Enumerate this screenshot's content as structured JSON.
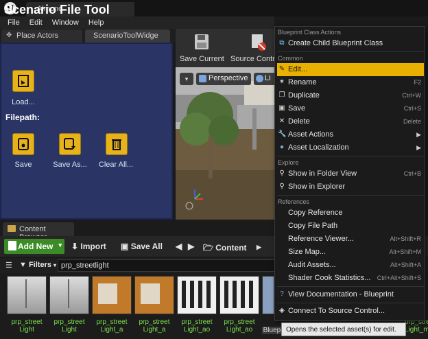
{
  "window": {
    "title": "Almono"
  },
  "menu": [
    "File",
    "Edit",
    "Window",
    "Help"
  ],
  "panel_tabs": {
    "place_actors": "Place Actors",
    "scenario_widget": "ScenarioToolWidge"
  },
  "scenario": {
    "title": "Scenario File Tool",
    "load": "Load...",
    "filepath": "Filepath:",
    "save": "Save",
    "save_as": "Save As...",
    "clear_all": "Clear All..."
  },
  "toolbar": {
    "save_current": "Save Current",
    "source_control": "Source Contro"
  },
  "viewport": {
    "perspective": "Perspective",
    "lit": "Li"
  },
  "content_browser": {
    "tab": "Content Browser",
    "add_new": "Add New",
    "import": "Import",
    "save_all": "Save All",
    "content": "Content",
    "filters": "Filters",
    "search": "prp_streetlight"
  },
  "assets": [
    {
      "l1": "prp_street",
      "l2": "Light"
    },
    {
      "l1": "prp_street",
      "l2": "Light"
    },
    {
      "l1": "prp_street",
      "l2": "Light_a"
    },
    {
      "l1": "prp_street",
      "l2": "Light_a"
    },
    {
      "l1": "prp_street",
      "l2": "Light_ao"
    },
    {
      "l1": "prp_street",
      "l2": "Light_ao"
    },
    {
      "l1": "",
      "l2": "Blueprin"
    },
    {
      "l1": "prp_street",
      "l2": "Light_m"
    }
  ],
  "context_menu": {
    "sec_blueprint": "Blueprint Class Actions",
    "create_child": "Create Child Blueprint Class",
    "sec_common": "Common",
    "edit": "Edit...",
    "rename": "Rename",
    "rename_sc": "F2",
    "duplicate": "Duplicate",
    "duplicate_sc": "Ctrl+W",
    "save": "Save",
    "save_sc": "Ctrl+S",
    "delete": "Delete",
    "delete_sc": "Delete",
    "asset_actions": "Asset Actions",
    "asset_localization": "Asset Localization",
    "sec_explore": "Explore",
    "show_folder": "Show in Folder View",
    "show_folder_sc": "Ctrl+B",
    "show_explorer": "Show in Explorer",
    "sec_references": "References",
    "copy_reference": "Copy Reference",
    "copy_path": "Copy File Path",
    "ref_viewer": "Reference Viewer...",
    "ref_viewer_sc": "Alt+Shift+R",
    "size_map": "Size Map...",
    "size_map_sc": "Alt+Shift+M",
    "audit": "Audit Assets...",
    "audit_sc": "Alt+Shift+A",
    "shader_stats": "Shader Cook Statistics...",
    "shader_stats_sc": "Ctrl+Alt+Shift+S",
    "view_docs": "View Documentation - Blueprint",
    "connect_sc": "Connect To Source Control..."
  },
  "tooltip": "Opens the selected asset(s) for edit.",
  "colors": {
    "highlight": "#e8b000",
    "scenario_bg": "#2a3566",
    "add_new_green": "#3b8c27",
    "asset_label": "#7be04a"
  }
}
